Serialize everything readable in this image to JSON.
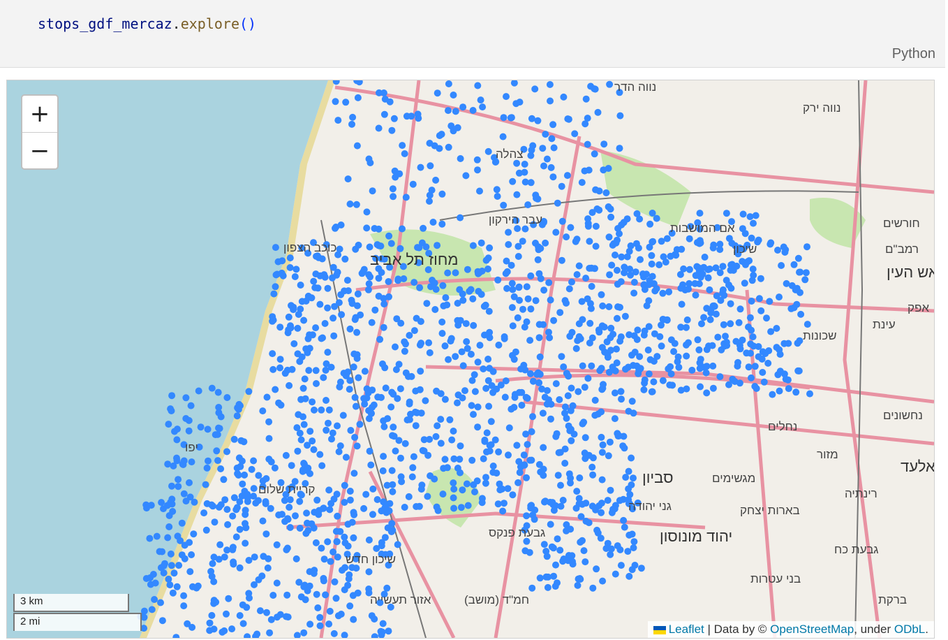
{
  "code": {
    "var": "stops_gdf_mercaz",
    "dot": ".",
    "fn": "explore",
    "parens": "()"
  },
  "cell": {
    "language": "Python"
  },
  "map": {
    "zoom_in": "+",
    "zoom_out": "−",
    "scale_km": "3 km",
    "scale_mi": "2 mi",
    "attribution": {
      "leaflet": "Leaflet",
      "sep": " | Data by © ",
      "osm": "OpenStreetMap",
      "under": ", under ",
      "odbl": "ODbL",
      "end": "."
    },
    "colors": {
      "sea": "#aad3df",
      "land": "#f2efe9",
      "park": "#c8e6b0",
      "road": "#e892a2",
      "stop": "#3388ff"
    },
    "labels": [
      "נווה הדר",
      "נווה ירק",
      "חורשים",
      "רמב\"ם",
      "ראש העין",
      "אפק",
      "עינת",
      "שכונות",
      "נחשונים",
      "אלעד",
      "נחלים",
      "מזור",
      "מגשימים",
      "רינתיה",
      "סביון",
      "גני יהודה",
      "בארות יצחק",
      "יהוד מונוסון",
      "גבעת כח",
      "בני עטרות",
      "ברקת",
      "שיכון חדש",
      "אזור תעשייה",
      "חמ\"ד (מושב)",
      "גבעת פנקס",
      "אם המושבות",
      "שיכון",
      "צהלה",
      "עבר הירקון",
      "כוכב הצפון",
      "מחוז תל אביב",
      "קריית שלום",
      "יפו"
    ]
  }
}
